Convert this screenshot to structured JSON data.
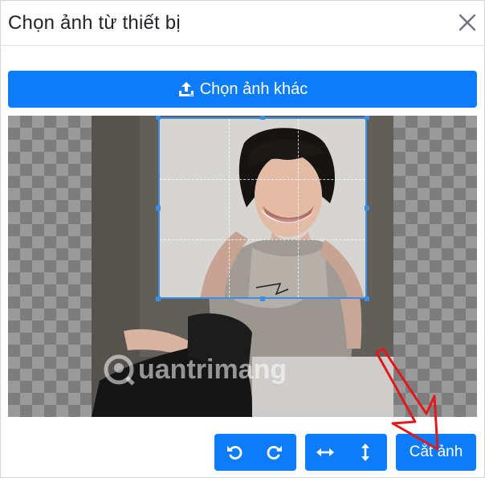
{
  "modal": {
    "title": "Chọn ảnh từ thiết bị"
  },
  "actions": {
    "choose_other_label": "Chọn ảnh khác",
    "crop_label": "Cắt ảnh"
  },
  "icons": {
    "close": "close-icon",
    "upload": "upload-icon",
    "rotate_left": "rotate-left-icon",
    "rotate_right": "rotate-right-icon",
    "flip_horizontal": "flip-horizontal-icon",
    "flip_vertical": "flip-vertical-icon"
  },
  "watermark": {
    "text": "uantrimang"
  },
  "colors": {
    "primary": "#0d7cfa",
    "crop_border": "#3b8ee6",
    "annotation_arrow": "#e0191b"
  }
}
